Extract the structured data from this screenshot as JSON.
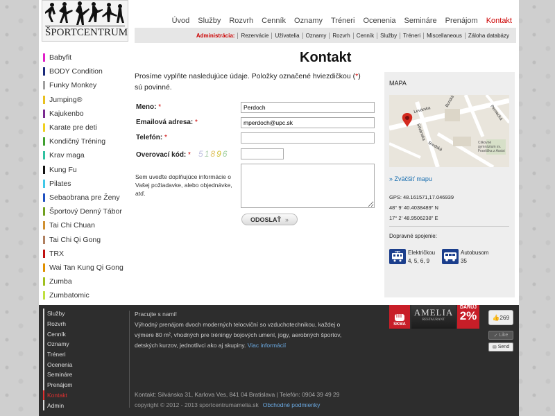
{
  "logo": {
    "text": "ŠPORTCENTRUM"
  },
  "topnav": [
    {
      "label": "Úvod"
    },
    {
      "label": "Služby"
    },
    {
      "label": "Rozvrh"
    },
    {
      "label": "Cenník"
    },
    {
      "label": "Oznamy"
    },
    {
      "label": "Tréneri"
    },
    {
      "label": "Ocenenia"
    },
    {
      "label": "Semináre"
    },
    {
      "label": "Prenájom"
    },
    {
      "label": "Kontakt"
    }
  ],
  "adminbar": {
    "label": "Administrácia:",
    "items": [
      "Rezervácie",
      "Užívatelia",
      "Oznamy",
      "Rozvrh",
      "Cenník",
      "Služby",
      "Tréneri",
      "Miscellaneous",
      "Záloha databázy"
    ]
  },
  "sidebar": [
    {
      "label": "Babyfit",
      "color": "#e020c8"
    },
    {
      "label": "BODY Condition",
      "color": "#1a2a7a"
    },
    {
      "label": "Funky Monkey",
      "color": "#a0a0a0"
    },
    {
      "label": "Jumping®",
      "color": "#e8c020"
    },
    {
      "label": "Kajukenbo",
      "color": "#7a2a90"
    },
    {
      "label": "Karate pre deti",
      "color": "#f0d020"
    },
    {
      "label": "Kondičný Tréning",
      "color": "#40a030"
    },
    {
      "label": "Krav maga",
      "color": "#30c0a0"
    },
    {
      "label": "Kung Fu",
      "color": "#111111"
    },
    {
      "label": "Pilates",
      "color": "#40c8e8"
    },
    {
      "label": "Sebaobrana pre Ženy",
      "color": "#2050c0"
    },
    {
      "label": "Športový Denný Tábor",
      "color": "#70a020"
    },
    {
      "label": "Tai Chi Chuan",
      "color": "#d09030"
    },
    {
      "label": "Tai Chi Qi Gong",
      "color": "#b08060"
    },
    {
      "label": "TRX",
      "color": "#c01010"
    },
    {
      "label": "Wai Tan Kung Qi Gong",
      "color": "#e09000"
    },
    {
      "label": "Zumba",
      "color": "#a0c020"
    },
    {
      "label": "Zumbatomic",
      "color": "#c0e040"
    }
  ],
  "main": {
    "title": "Kontakt",
    "intro_a": "Prosíme vyplňte nasledujúce údaje. Položky označené hviezdičkou (",
    "intro_star": "*",
    "intro_b": ") sú povinné."
  },
  "form": {
    "name_label": "Meno:",
    "name_value": "Perdoch",
    "email_label": "Emailová adresa:",
    "email_value": "mperdoch@upc.sk",
    "phone_label": "Telefón:",
    "phone_value": "",
    "captcha_label": "Overovací kód:",
    "captcha_chars": [
      {
        "c": "5",
        "color": "#c0c0e0"
      },
      {
        "c": "1",
        "color": "#b0d0b0"
      },
      {
        "c": "8",
        "color": "#e0c060"
      },
      {
        "c": "9",
        "color": "#d0c030"
      },
      {
        "c": "6",
        "color": "#a0d0a0"
      }
    ],
    "star": "*",
    "message_label": "Sem uveďte doplňujúce informácie o Vašej požiadavke, alebo objednávke, atď.",
    "submit_label": "ODOSLAŤ",
    "submit_arrow": "»"
  },
  "map": {
    "title": "MAPA",
    "streets": [
      "Levárska",
      "Borská",
      "Pernecká",
      "Silvánska",
      "Brodská",
      "Cilkovné gymnázium sv. Františka z Assisi"
    ],
    "link_prefix": "»",
    "link_label": "Zväčšiť mapu",
    "gps": "GPS: 48.161571,17.046939",
    "lat": "48° 9' 40.4038489\" N",
    "lon": "17° 2' 48.9506238\" E",
    "transport_label": "Dopravné spojenie:",
    "tram_label": "Električkou",
    "tram_lines": "4, 5, 6, 9",
    "bus_label": "Autobusom",
    "bus_lines": "35"
  },
  "footer": {
    "links": [
      "Služby",
      "Rozvrh",
      "Cenník",
      "Oznamy",
      "Tréneri",
      "Ocenenia",
      "Semináre",
      "Prenájom",
      "Kontakt",
      "Admin"
    ],
    "active": "Kontakt",
    "text_1": "Pracujte s nami!",
    "text_2": "Výhodný prenájom dvoch moderných telocviční so vzduchotechnikou, každej o výmere 80 m², vhodných pre tréningy bojových umení, jogy, aerobných športov, detských kurzov, jednotlivci ako aj skupiny.",
    "more_label": "Viac informácií",
    "contact": "Kontakt: Silvánska 31, Karlova Ves, 841 04 Bratislava | Telefón: 0904 39 49 29",
    "copyright": "copyright © 2012 - 2013 sportcentrumamelia.sk",
    "terms_label": "Obchodné podmienky",
    "skma": "SKMA",
    "amelia_1": "AMELIA",
    "amelia_2": "RESTAURANT",
    "daruj_1": "DARUJ",
    "daruj_2": "2%",
    "like_count": "269",
    "like_label": "Like",
    "send_label": "Send"
  }
}
